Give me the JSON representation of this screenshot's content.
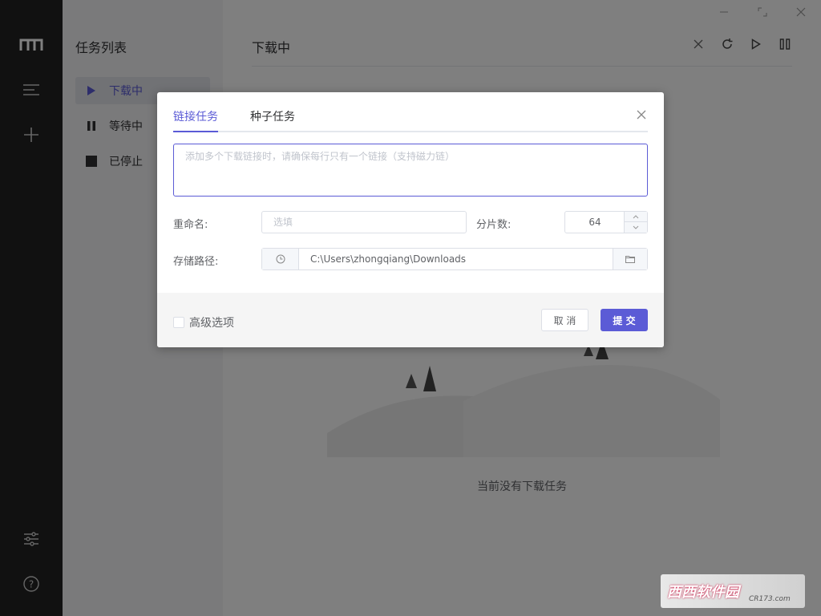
{
  "rail": {
    "logo": "motrix-logo-icon",
    "items": [
      "task-list-icon",
      "add-task-icon"
    ],
    "bottom": [
      "preferences-icon",
      "help-icon"
    ]
  },
  "sidebar": {
    "title": "任务列表",
    "items": [
      {
        "label": "下载中",
        "icon": "play-icon",
        "active": true
      },
      {
        "label": "等待中",
        "icon": "pause-icon",
        "active": false
      },
      {
        "label": "已停止",
        "icon": "stop-icon",
        "active": false
      }
    ]
  },
  "main": {
    "title": "下载中",
    "tools": [
      "close-icon",
      "refresh-icon",
      "resume-all-icon",
      "pause-all-icon"
    ],
    "empty_text": "当前没有下载任务"
  },
  "dialog": {
    "tabs": [
      {
        "label": "链接任务",
        "active": true
      },
      {
        "label": "种子任务",
        "active": false
      }
    ],
    "url_placeholder": "添加多个下载链接时，请确保每行只有一个链接（支持磁力链）",
    "rename_label": "重命名:",
    "rename_placeholder": "选填",
    "split_label": "分片数:",
    "split_value": "64",
    "path_label": "存储路径:",
    "path_value": "C:\\Users\\zhongqiang\\Downloads",
    "advanced_label": "高级选项",
    "cancel_label": "取 消",
    "submit_label": "提 交"
  },
  "watermark": {
    "text": "西西软件园",
    "sub": "CR173.com"
  },
  "colors": {
    "accent": "#5b5bd6",
    "rail": "#232323",
    "sidebar": "#f4f5f7"
  }
}
